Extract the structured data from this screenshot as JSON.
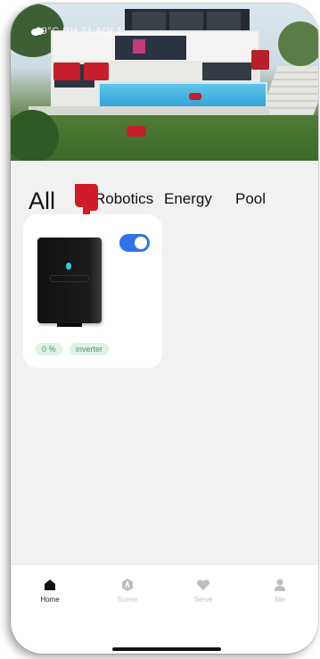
{
  "status": {
    "text": "29°C  RH 71  AQI 1"
  },
  "tabs": [
    {
      "label": "All"
    },
    {
      "label": "Robotics"
    },
    {
      "label": "Energy"
    },
    {
      "label": "Pool"
    }
  ],
  "device_card": {
    "toggle_on": true,
    "chips": [
      "0 %",
      "inverter"
    ]
  },
  "bottom_nav": [
    {
      "label": "Home",
      "icon": "home-icon",
      "active": true
    },
    {
      "label": "Scene",
      "icon": "scene-icon",
      "active": false
    },
    {
      "label": "Serve",
      "icon": "heart-icon",
      "active": false
    },
    {
      "label": "Me",
      "icon": "person-icon",
      "active": false
    }
  ],
  "colors": {
    "accent": "#2f74e8",
    "pointer": "#d11a2a",
    "chip_bg": "#dff3e6",
    "chip_text": "#4a9a6a"
  }
}
